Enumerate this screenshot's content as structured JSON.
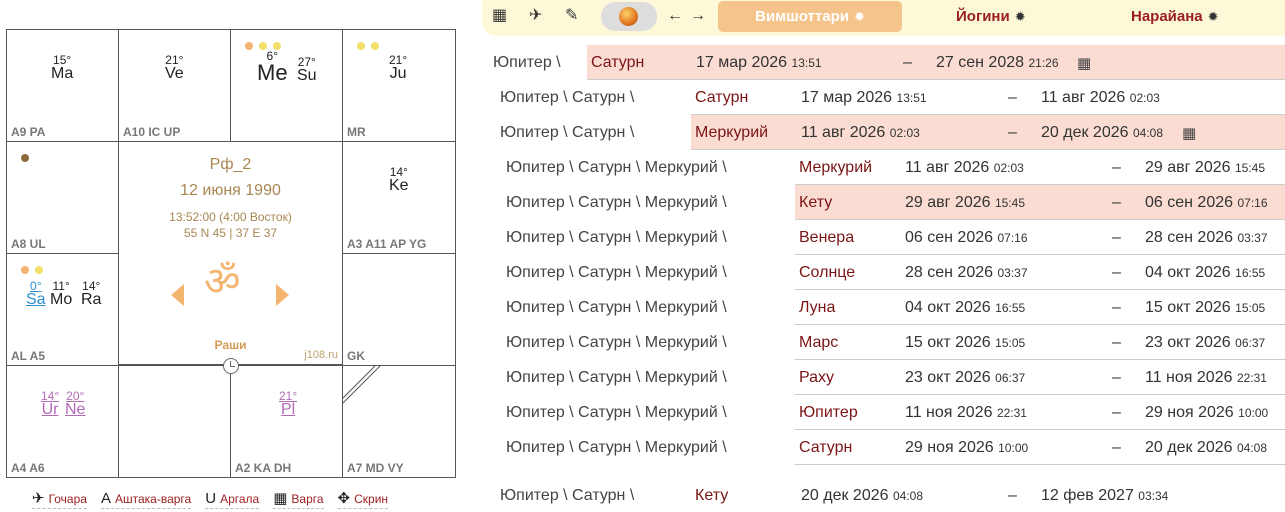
{
  "chart": {
    "houses": [
      {
        "id": "h9",
        "label": "A9 PA",
        "planets": [
          {
            "deg": "15°",
            "name": "Ma"
          }
        ]
      },
      {
        "id": "h10",
        "label": "A10 IC UP",
        "planets": [
          {
            "deg": "21°",
            "name": "Ve"
          }
        ]
      },
      {
        "id": "h11",
        "label": "",
        "planets": [
          {
            "deg": "6°",
            "name": "Me"
          },
          {
            "deg": "27°",
            "name": "Su"
          }
        ]
      },
      {
        "id": "h12",
        "label": "MR",
        "planets": [
          {
            "deg": "21°",
            "name": "Ju"
          }
        ]
      },
      {
        "id": "h8",
        "label": "A8 UL",
        "planets": []
      },
      {
        "id": "h1",
        "label": "A3 A11 AP YG",
        "planets": [
          {
            "deg": "14°",
            "name": "Ke"
          }
        ]
      },
      {
        "id": "h7",
        "label": "AL A5",
        "planets": [
          {
            "deg": "0°",
            "name": "Sa"
          },
          {
            "deg": "11°",
            "name": "Mo"
          },
          {
            "deg": "14°",
            "name": "Ra"
          }
        ]
      },
      {
        "id": "h2",
        "label": "GK",
        "planets": []
      },
      {
        "id": "h6",
        "label": "A4 A6",
        "planets": [
          {
            "deg": "14°",
            "name": "Ur"
          },
          {
            "deg": "20°",
            "name": "Ne"
          }
        ]
      },
      {
        "id": "h5",
        "label": "",
        "planets": []
      },
      {
        "id": "h4",
        "label": "A2 KA DH",
        "planets": [
          {
            "deg": "21°",
            "name": "Pl"
          }
        ]
      },
      {
        "id": "h3",
        "label": "A7 MD VY",
        "planets": []
      }
    ],
    "center": {
      "name": "Рф_2",
      "date": "12 июня 1990",
      "time": "13:52:00 (4:00 Восток)",
      "coords": "55 N 45 | 37 E 37",
      "om": "ॐ",
      "mode": "Раши",
      "site": "j108.ru"
    },
    "colors": {
      "border": "#555555",
      "om": "#f4b570",
      "text_gold": "#a98652"
    }
  },
  "bottom_nav": [
    {
      "icon": "plane-icon",
      "glyph": "✈",
      "label": "Гочара"
    },
    {
      "icon": "letter-a-icon",
      "glyph": "A",
      "label": "Аштака-варга"
    },
    {
      "icon": "magnet-icon",
      "glyph": "U",
      "label": "Аргала"
    },
    {
      "icon": "grid-icon",
      "glyph": "▦",
      "label": "Варга"
    },
    {
      "icon": "move-icon",
      "glyph": "✥",
      "label": "Скрин"
    }
  ],
  "toolbar": {
    "icons": [
      {
        "name": "calendar-icon",
        "glyph": "▦"
      },
      {
        "name": "plane-icon",
        "glyph": "✈"
      },
      {
        "name": "edit-icon",
        "glyph": "✎"
      },
      {
        "name": "arrow-left-icon",
        "glyph": "←"
      },
      {
        "name": "arrow-right-icon",
        "glyph": "→"
      }
    ],
    "active_dasha": "Вимшоттари",
    "dasha_yogini": "Йогини",
    "dasha_narayana": "Нарайана",
    "gear": "✹"
  },
  "dasha_rows": [
    {
      "path": "Юпитер \\",
      "planet": "Сатурн",
      "d1": "17 мар 2026",
      "t1": "13:51",
      "d2": "27 сен 2028",
      "t2": "21:26",
      "hl": true,
      "cal": true,
      "lvl": 0
    },
    {
      "path": "Юпитер \\ Сатурн \\",
      "planet": "Сатурн",
      "d1": "17 мар 2026",
      "t1": "13:51",
      "d2": "11 авг 2026",
      "t2": "02:03",
      "hl": false,
      "cal": false,
      "lvl": 1
    },
    {
      "path": "Юпитер \\ Сатурн \\",
      "planet": "Меркурий",
      "d1": "11 авг 2026",
      "t1": "02:03",
      "d2": "20 дек 2026",
      "t2": "04:08",
      "hl": true,
      "cal": true,
      "lvl": 1
    },
    {
      "path": "Юпитер \\ Сатурн \\ Меркурий \\",
      "planet": "Меркурий",
      "d1": "11 авг 2026",
      "t1": "02:03",
      "d2": "29 авг 2026",
      "t2": "15:45",
      "hl": false,
      "cal": false,
      "lvl": 2
    },
    {
      "path": "Юпитер \\ Сатурн \\ Меркурий \\",
      "planet": "Кету",
      "d1": "29 авг 2026",
      "t1": "15:45",
      "d2": "06 сен 2026",
      "t2": "07:16",
      "hl": true,
      "cal": false,
      "lvl": 2
    },
    {
      "path": "Юпитер \\ Сатурн \\ Меркурий \\",
      "planet": "Венера",
      "d1": "06 сен 2026",
      "t1": "07:16",
      "d2": "28 сен 2026",
      "t2": "03:37",
      "hl": false,
      "cal": false,
      "lvl": 2
    },
    {
      "path": "Юпитер \\ Сатурн \\ Меркурий \\",
      "planet": "Солнце",
      "d1": "28 сен 2026",
      "t1": "03:37",
      "d2": "04 окт 2026",
      "t2": "16:55",
      "hl": false,
      "cal": false,
      "lvl": 2
    },
    {
      "path": "Юпитер \\ Сатурн \\ Меркурий \\",
      "planet": "Луна",
      "d1": "04 окт 2026",
      "t1": "16:55",
      "d2": "15 окт 2026",
      "t2": "15:05",
      "hl": false,
      "cal": false,
      "lvl": 2
    },
    {
      "path": "Юпитер \\ Сатурн \\ Меркурий \\",
      "planet": "Марс",
      "d1": "15 окт 2026",
      "t1": "15:05",
      "d2": "23 окт 2026",
      "t2": "06:37",
      "hl": false,
      "cal": false,
      "lvl": 2
    },
    {
      "path": "Юпитер \\ Сатурн \\ Меркурий \\",
      "planet": "Раху",
      "d1": "23 окт 2026",
      "t1": "06:37",
      "d2": "11 ноя 2026",
      "t2": "22:31",
      "hl": false,
      "cal": false,
      "lvl": 2
    },
    {
      "path": "Юпитер \\ Сатурн \\ Меркурий \\",
      "planet": "Юпитер",
      "d1": "11 ноя 2026",
      "t1": "22:31",
      "d2": "29 ноя 2026",
      "t2": "10:00",
      "hl": false,
      "cal": false,
      "lvl": 2
    },
    {
      "path": "Юпитер \\ Сатурн \\ Меркурий \\",
      "planet": "Сатурн",
      "d1": "29 ноя 2026",
      "t1": "10:00",
      "d2": "20 дек 2026",
      "t2": "04:08",
      "hl": false,
      "cal": false,
      "lvl": 2
    },
    {
      "path": "Юпитер \\ Сатурн \\",
      "planet": "Кету",
      "d1": "20 дек 2026",
      "t1": "04:08",
      "d2": "12 фев 2027",
      "t2": "03:34",
      "hl": false,
      "cal": false,
      "lvl": 1
    }
  ],
  "dash": "–",
  "cal_glyph": "▦"
}
